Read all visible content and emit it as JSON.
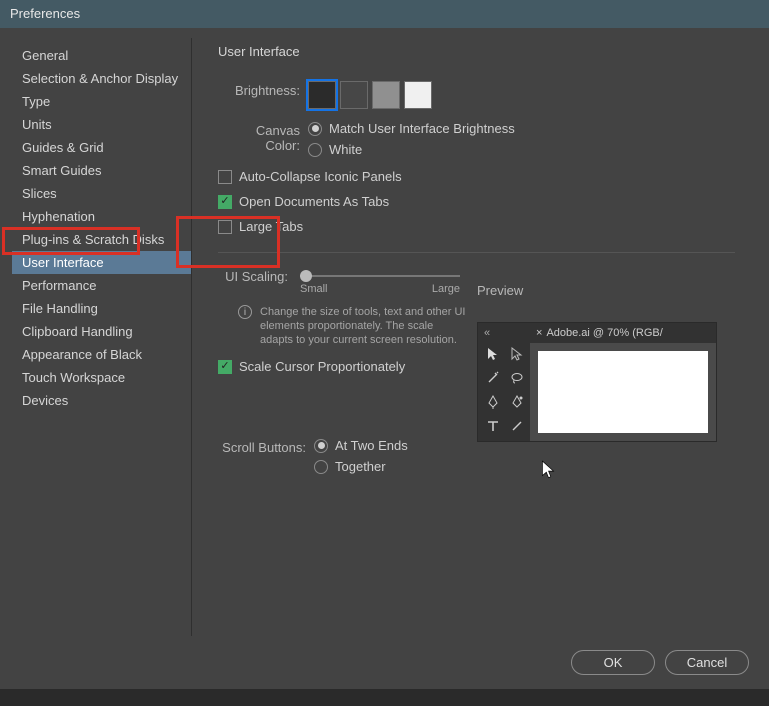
{
  "window": {
    "title": "Preferences"
  },
  "sidebar": {
    "items": [
      {
        "label": "General"
      },
      {
        "label": "Selection & Anchor Display"
      },
      {
        "label": "Type"
      },
      {
        "label": "Units"
      },
      {
        "label": "Guides & Grid"
      },
      {
        "label": "Smart Guides"
      },
      {
        "label": "Slices"
      },
      {
        "label": "Hyphenation"
      },
      {
        "label": "Plug-ins & Scratch Disks"
      },
      {
        "label": "User Interface"
      },
      {
        "label": "Performance"
      },
      {
        "label": "File Handling"
      },
      {
        "label": "Clipboard Handling"
      },
      {
        "label": "Appearance of Black"
      },
      {
        "label": "Touch Workspace"
      },
      {
        "label": "Devices"
      }
    ],
    "active_index": 9
  },
  "panel": {
    "title": "User Interface",
    "brightness": {
      "label": "Brightness:",
      "swatches": [
        "#2b2b2b",
        "#474747",
        "#909090",
        "#f0f0f0"
      ],
      "selected_index": 0
    },
    "canvas_color": {
      "label": "Canvas Color:",
      "options": [
        {
          "label": "Match User Interface Brightness",
          "checked": true
        },
        {
          "label": "White",
          "checked": false
        }
      ]
    },
    "checks": [
      {
        "label": "Auto-Collapse Iconic Panels",
        "checked": false
      },
      {
        "label": "Open Documents As Tabs",
        "checked": true
      },
      {
        "label": "Large Tabs",
        "checked": false
      }
    ],
    "ui_scaling": {
      "label": "UI Scaling:",
      "min_label": "Small",
      "max_label": "Large",
      "hint": "Change the size of tools, text and other UI elements proportionately. The scale adapts to your current screen resolution."
    },
    "scale_cursor": {
      "label": "Scale Cursor Proportionately",
      "checked": true
    },
    "scroll_buttons": {
      "label": "Scroll Buttons:",
      "options": [
        {
          "label": "At Two Ends",
          "checked": true
        },
        {
          "label": "Together",
          "checked": false
        }
      ]
    },
    "preview": {
      "label": "Preview",
      "tab": "Adobe.ai @ 70% (RGB/"
    }
  },
  "footer": {
    "ok": "OK",
    "cancel": "Cancel"
  }
}
